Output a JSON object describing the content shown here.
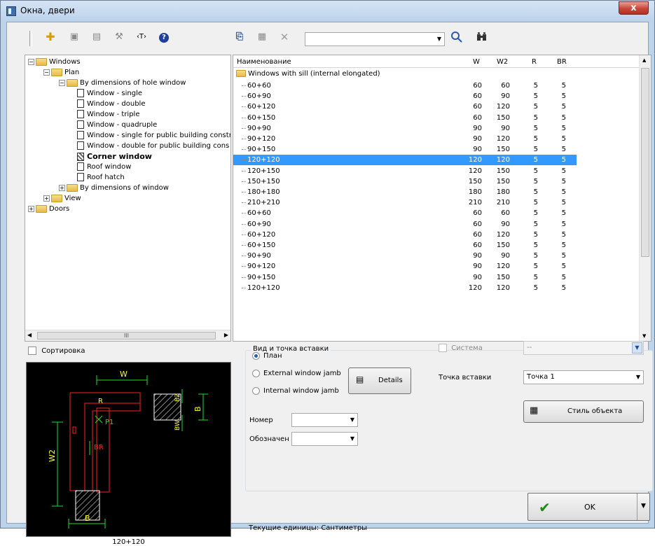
{
  "window": {
    "title": "Окна, двери",
    "close_glyph": "x"
  },
  "toolbar": {
    "icons": [
      "add-icon",
      "edit-icon",
      "list-icon",
      "tools-icon",
      "text-tag-icon",
      "help-icon",
      "copy-icon",
      "properties-icon",
      "delete-icon",
      "search-icon",
      "binoculars-icon"
    ],
    "text_tag_glyph": "‹T›",
    "help_glyph": "?",
    "search_value": ""
  },
  "tree": {
    "items": [
      {
        "label": "Windows",
        "expander": "−",
        "type": "folder"
      },
      {
        "label": "Plan",
        "expander": "−",
        "type": "folder"
      },
      {
        "label": "By dimensions of hole window",
        "expander": "−",
        "type": "folder"
      },
      {
        "label": "Window - single",
        "type": "doc"
      },
      {
        "label": "Window - double",
        "type": "doc"
      },
      {
        "label": "Window - triple",
        "type": "doc"
      },
      {
        "label": "Window - quadruple",
        "type": "doc"
      },
      {
        "label": "Window - single for public building constr",
        "type": "doc"
      },
      {
        "label": "Window - double for public building cons",
        "type": "doc"
      },
      {
        "label": "Corner window",
        "type": "doc-selected"
      },
      {
        "label": "Roof window",
        "type": "doc"
      },
      {
        "label": "Roof hatch",
        "type": "doc"
      },
      {
        "label": "By dimensions of window",
        "expander": "+",
        "type": "folder"
      },
      {
        "label": "View",
        "expander": "+",
        "type": "folder"
      },
      {
        "label": "Doors",
        "expander": "+",
        "type": "folder"
      }
    ],
    "hscroll_thumb_glyph": "III"
  },
  "grid": {
    "columns": {
      "name": "Наименование",
      "w": "W",
      "w2": "W2",
      "r": "R",
      "br": "BR"
    },
    "group_label": "Windows with sill (internal elongated)",
    "rows": [
      {
        "name": "60+60",
        "w": "60",
        "w2": "60",
        "r": "5",
        "br": "5"
      },
      {
        "name": "60+90",
        "w": "60",
        "w2": "90",
        "r": "5",
        "br": "5"
      },
      {
        "name": "60+120",
        "w": "60",
        "w2": "120",
        "r": "5",
        "br": "5"
      },
      {
        "name": "60+150",
        "w": "60",
        "w2": "150",
        "r": "5",
        "br": "5"
      },
      {
        "name": "90+90",
        "w": "90",
        "w2": "90",
        "r": "5",
        "br": "5"
      },
      {
        "name": "90+120",
        "w": "90",
        "w2": "120",
        "r": "5",
        "br": "5"
      },
      {
        "name": "90+150",
        "w": "90",
        "w2": "150",
        "r": "5",
        "br": "5"
      },
      {
        "name": "120+120",
        "w": "120",
        "w2": "120",
        "r": "5",
        "br": "5",
        "selected": true
      },
      {
        "name": "120+150",
        "w": "120",
        "w2": "150",
        "r": "5",
        "br": "5"
      },
      {
        "name": "150+150",
        "w": "150",
        "w2": "150",
        "r": "5",
        "br": "5"
      },
      {
        "name": "180+180",
        "w": "180",
        "w2": "180",
        "r": "5",
        "br": "5"
      },
      {
        "name": "210+210",
        "w": "210",
        "w2": "210",
        "r": "5",
        "br": "5"
      },
      {
        "name": "60+60",
        "w": "60",
        "w2": "60",
        "r": "5",
        "br": "5"
      },
      {
        "name": "60+90",
        "w": "60",
        "w2": "90",
        "r": "5",
        "br": "5"
      },
      {
        "name": "60+120",
        "w": "60",
        "w2": "120",
        "r": "5",
        "br": "5"
      },
      {
        "name": "60+150",
        "w": "60",
        "w2": "150",
        "r": "5",
        "br": "5"
      },
      {
        "name": "90+90",
        "w": "90",
        "w2": "90",
        "r": "5",
        "br": "5"
      },
      {
        "name": "90+120",
        "w": "90",
        "w2": "120",
        "r": "5",
        "br": "5"
      },
      {
        "name": "90+150",
        "w": "90",
        "w2": "150",
        "r": "5",
        "br": "5"
      },
      {
        "name": "120+120",
        "w": "120",
        "w2": "120",
        "r": "5",
        "br": "5"
      }
    ]
  },
  "sorting": {
    "label": "Сортировка",
    "checked": false
  },
  "preview": {
    "caption": "120+120",
    "labels": {
      "w": "W",
      "r": "R",
      "bz": "BZ",
      "b": "B",
      "bw": "BW",
      "p1": "P1",
      "br": "BR",
      "w2": "W2",
      "b_bottom": "B"
    }
  },
  "insert": {
    "legend": "Вид и точка вставки",
    "radio_plan": "План",
    "radio_external": "External window jamb",
    "radio_internal": "Internal window jamb",
    "details_label": "Details",
    "number_label": "Номер",
    "number_value": "",
    "designation_label": "Обозначен",
    "designation_value": "",
    "system_label": "Система",
    "system_value": "--",
    "insert_point_label": "Точка вставки",
    "insert_point_value": "Точка 1",
    "object_style_label": "Стиль объекта"
  },
  "status": {
    "units": "Текущие единицы: Сантиметры"
  },
  "ok": {
    "label": "OK"
  },
  "colors": {
    "selection": "#3399ff",
    "preview_bg": "#000000",
    "preview_red": "#ff2020",
    "preview_green": "#22dd22",
    "preview_yellow": "#ffff30"
  }
}
